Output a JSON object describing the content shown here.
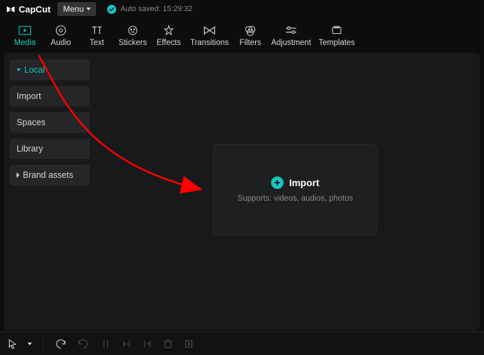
{
  "brand": "CapCut",
  "menu_label": "Menu",
  "autosave_label": "Auto saved: 15:29:32",
  "tabs": {
    "media": "Media",
    "audio": "Audio",
    "text": "Text",
    "stickers": "Stickers",
    "effects": "Effects",
    "transitions": "Transitions",
    "filters": "Filters",
    "adjustment": "Adjustment",
    "templates": "Templates"
  },
  "sidebar": {
    "local": "Local",
    "import": "Import",
    "spaces": "Spaces",
    "library": "Library",
    "brand_assets": "Brand assets"
  },
  "import_panel": {
    "title": "Import",
    "subtitle": "Supports: videos, audios, photos"
  }
}
